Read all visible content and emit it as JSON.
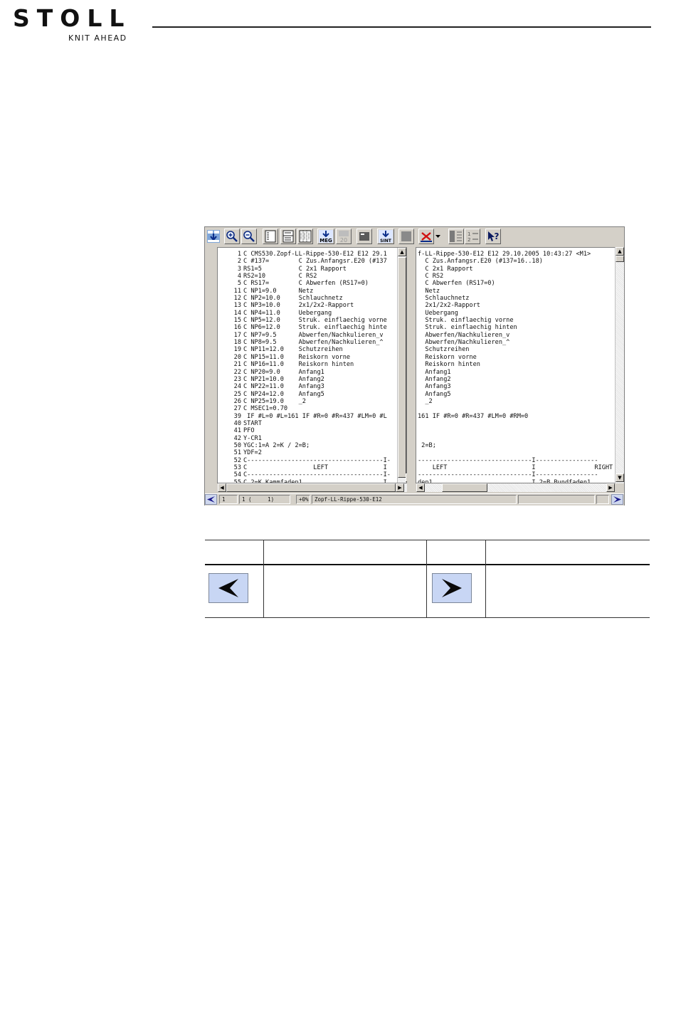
{
  "header": {
    "logo_text": "STOLL",
    "tagline": "KNIT AHEAD"
  },
  "toolbar": {
    "icons": [
      "sequence-view-icon",
      "zoom-in-icon",
      "zoom-out-icon",
      "single-pane-icon",
      "split-pane-icon",
      "triple-pane-icon",
      "meg-import-icon",
      "disabled-20-icon",
      "open-file-icon",
      "export-sint-icon",
      "disabled-stop-icon",
      "close-compare-icon",
      "dropdown-arrow-icon",
      "column-layout-icon",
      "numbered-list-icon",
      "help-pointer-icon"
    ],
    "meg_label": "MEG",
    "num_label": "20",
    "sint_label": "SINT",
    "help_label": "?"
  },
  "left_pane": {
    "lines": [
      {
        "n": "1",
        "t": "C CMS530.Zopf-LL-Rippe-530-E12 E12 29.1"
      },
      {
        "n": "2",
        "t": "C #137=        C Zus.Anfangsr.E20 (#137"
      },
      {
        "n": "3",
        "t": "RS1=5          C 2x1 Rapport"
      },
      {
        "n": "4",
        "t": "RS2=10         C RS2"
      },
      {
        "n": "5",
        "t": "C RS17=        C Abwerfen (RS17=0)"
      },
      {
        "n": "11",
        "t": "C NP1=9.0      Netz"
      },
      {
        "n": "12",
        "t": "C NP2=10.0     Schlauchnetz"
      },
      {
        "n": "13",
        "t": "C NP3=10.0     2x1/2x2-Rapport"
      },
      {
        "n": "14",
        "t": "C NP4=11.0     Uebergang"
      },
      {
        "n": "15",
        "t": "C NP5=12.0     Struk. einflaechig vorne"
      },
      {
        "n": "16",
        "t": "C NP6=12.0     Struk. einflaechig hinte"
      },
      {
        "n": "17",
        "t": "C NP7=9.5      Abwerfen/Nachkulieren_v"
      },
      {
        "n": "18",
        "t": "C NP8=9.5      Abwerfen/Nachkulieren_^"
      },
      {
        "n": "19",
        "t": "C NP11=12.0    Schutzreihen"
      },
      {
        "n": "20",
        "t": "C NP15=11.0    Reiskorn vorne"
      },
      {
        "n": "21",
        "t": "C NP16=11.0    Reiskorn hinten"
      },
      {
        "n": "22",
        "t": "C NP20=9.0     Anfang1"
      },
      {
        "n": "23",
        "t": "C NP21=10.0    Anfang2"
      },
      {
        "n": "24",
        "t": "C NP22=11.0    Anfang3"
      },
      {
        "n": "25",
        "t": "C NP24=12.0    Anfang5"
      },
      {
        "n": "26",
        "t": "C NP25=19.0    _2"
      },
      {
        "n": "27",
        "t": "C MSEC1=0.70"
      },
      {
        "n": "39",
        "t": " IF #L=0 #L=161 IF #R=0 #R=437 #LM=0 #L"
      },
      {
        "n": "40",
        "t": "START"
      },
      {
        "n": "41",
        "t": "PFO"
      },
      {
        "n": "42",
        "t": "Y-CR1"
      },
      {
        "n": "50",
        "t": "YGC:1=A 2=K / 2=B;"
      },
      {
        "n": "51",
        "t": "YDF=2"
      },
      {
        "n": "52",
        "t": "C-------------------------------------I-"
      },
      {
        "n": "53",
        "t": "C                  LEFT               I"
      },
      {
        "n": "54",
        "t": "C-------------------------------------I-"
      },
      {
        "n": "55",
        "t": "C 2=K Kammfaden1                      I"
      }
    ]
  },
  "right_pane": {
    "lines": [
      "f-LL-Rippe-530-E12 E12 29.10.2005 10:43:27 <M1>",
      "  C Zus.Anfangsr.E20 (#137=16..18)",
      "  C 2x1 Rapport",
      "  C RS2",
      "  C Abwerfen (RS17=0)",
      "  Netz",
      "  Schlauchnetz",
      "  2x1/2x2-Rapport",
      "  Uebergang",
      "  Struk. einflaechig vorne",
      "  Struk. einflaechig hinten",
      "  Abwerfen/Nachkulieren_v",
      "  Abwerfen/Nachkulieren_^",
      "  Schutzreihen",
      "  Reiskorn vorne",
      "  Reiskorn hinten",
      "  Anfang1",
      "  Anfang2",
      "  Anfang3",
      "  Anfang5",
      "  _2",
      "",
      "161 IF #R=0 #R=437 #LM=0 #RM=0",
      "",
      "",
      "",
      " 2=B;",
      "",
      "-------------------------------I-----------------",
      "    LEFT                       I                RIGHT",
      "-------------------------------I-----------------",
      "den1                           I 2=B Bundfaden1"
    ]
  },
  "statusbar": {
    "line_field": "1",
    "pos_field": "1 (     1)",
    "pct_field": "+0%",
    "file_field": "Zopf-LL-Rippe-530-E12"
  },
  "table": {
    "prev_icon": "arrow-left-icon",
    "next_icon": "arrow-right-icon"
  },
  "colors": {
    "window_face": "#d4d0c8",
    "button_blue": "#c8d6f4",
    "nav_arrow": "#1a1a8c"
  }
}
